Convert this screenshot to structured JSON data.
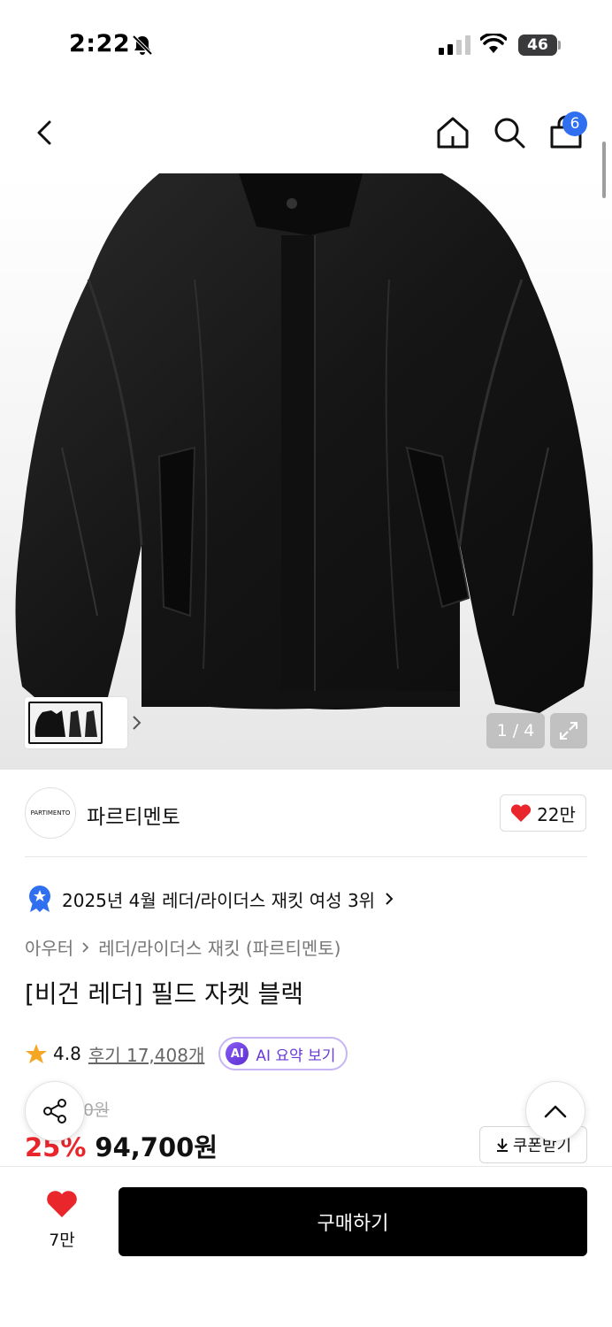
{
  "status_bar": {
    "time": "2:22",
    "battery": "46"
  },
  "nav": {
    "cart_count": "6"
  },
  "gallery": {
    "counter": "1 / 4",
    "thumbnail_count": 4
  },
  "brand": {
    "logo_text": "PARTIMENTO",
    "name": "파르티멘토",
    "likes": "22만"
  },
  "ranking": {
    "text": "2025년 4월 레더/라이더스 재킷 여성 3위"
  },
  "breadcrumb": {
    "category": "아우터",
    "subcategory": "레더/라이더스 재킷 (파르티멘토)"
  },
  "product": {
    "title": "[비건 레더] 필드 자켓 블랙",
    "rating": "4.8",
    "reviews": "후기 17,408개",
    "ai_badge": "AI",
    "ai_summary": "AI 요약 보기",
    "original_price_visible": "0원",
    "discount_visible": "25%",
    "price": "94,700원",
    "coupon": "쿠폰받기"
  },
  "bottom_bar": {
    "wishlist_count": "7만",
    "buy_label": "구매하기"
  },
  "colors": {
    "accent_red": "#e8262b",
    "badge_blue": "#2f6ff0",
    "ai_purple": "#6a3bd8",
    "buy_button": "#000000"
  },
  "icons": [
    "bell-off-icon",
    "signal-icon",
    "wifi-icon",
    "back-icon",
    "home-icon",
    "search-icon",
    "cart-icon",
    "expand-icon",
    "heart-icon",
    "star-icon",
    "ranking-badge-icon",
    "share-icon",
    "chevron-up-icon",
    "download-icon"
  ]
}
